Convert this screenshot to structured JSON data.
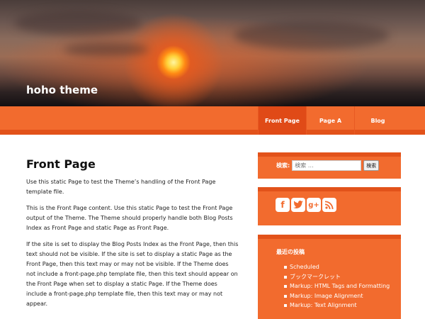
{
  "site": {
    "title": "hoho theme"
  },
  "nav": [
    {
      "label": "Front Page"
    },
    {
      "label": "Page A"
    },
    {
      "label": "Blog"
    }
  ],
  "main": {
    "title": "Front Page",
    "paragraphs": [
      "Use this static Page to test the Theme’s handling of the Front Page template file.",
      "This is the Front Page content. Use this static Page to test the Front Page output of the Theme. The Theme should properly handle both Blog Posts Index as Front Page and static Page as Front Page.",
      "If the site is set to display the Blog Posts Index as the Front Page, then this text should not be visible. If the site is set to display a static Page as the Front Page, then this text may or may not be visible. If the Theme does not include a front-page.php template file, then this text should appear on the Front Page when set to display a static Page. If the Theme does include a front-page.php template file, then this text may or may not appear."
    ]
  },
  "sidebar": {
    "search": {
      "label": "検索:",
      "placeholder": "検索 …",
      "button": "検索"
    },
    "social": [
      {
        "icon": "facebook-icon",
        "glyph": "f"
      },
      {
        "icon": "twitter-icon",
        "glyph": "t"
      },
      {
        "icon": "google-plus-icon",
        "glyph": "g+"
      },
      {
        "icon": "rss-icon",
        "glyph": "))"
      }
    ],
    "recent": {
      "title": "最近の投稿",
      "items": [
        "Scheduled",
        "ブックマークレット",
        "Markup: HTML Tags and Formatting",
        "Markup: Image Alignment",
        "Markup: Text Alignment"
      ]
    }
  },
  "colors": {
    "accent": "#f26b2e",
    "accent_dark": "#e2521a",
    "active_nav": "#e04a17"
  }
}
